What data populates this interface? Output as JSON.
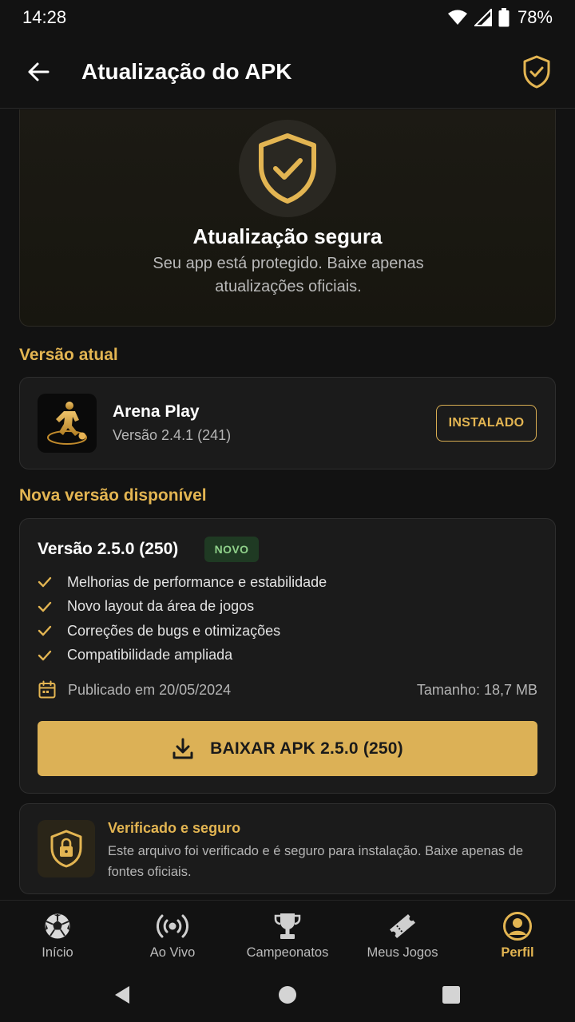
{
  "status_bar": {
    "time": "14:28",
    "battery": "78%"
  },
  "app_bar": {
    "title": "Atualização do APK"
  },
  "hero": {
    "title": "Atualização segura",
    "subtitle": "Seu app está protegido. Baixe apenas atualizações oficiais."
  },
  "current_version": {
    "section_title": "Versão atual",
    "app_name": "Arena Play",
    "version": "Versão 2.4.1 (241)",
    "status_badge": "INSTALADO"
  },
  "new_version": {
    "section_title": "Nova versão disponível",
    "version": "Versão 2.5.0 (250)",
    "badge": "NOVO",
    "features": [
      "Melhorias de performance e estabilidade",
      "Novo layout da área de jogos",
      "Correções de bugs e otimizações",
      "Compatibilidade ampliada"
    ],
    "published": "Publicado em 20/05/2024",
    "size": "Tamanho: 18,7 MB",
    "download_label": "BAIXAR APK 2.5.0 (250)"
  },
  "verification": {
    "title": "Verificado e seguro",
    "text": "Este arquivo foi verificado e é seguro para instalação. Baixe apenas de fontes oficiais."
  },
  "bottom_nav": {
    "items": [
      {
        "label": "Início",
        "icon": "soccer-ball-icon",
        "active": false
      },
      {
        "label": "Ao Vivo",
        "icon": "broadcast-icon",
        "active": false
      },
      {
        "label": "Campeonatos",
        "icon": "trophy-icon",
        "active": false
      },
      {
        "label": "Meus Jogos",
        "icon": "ticket-icon",
        "active": false
      },
      {
        "label": "Perfil",
        "icon": "profile-icon",
        "active": true
      }
    ]
  },
  "colors": {
    "accent": "#e3b552",
    "button": "#dcb156",
    "background": "#121212",
    "card": "#1b1b1b",
    "new_badge_bg": "#1f3a23",
    "new_badge_text": "#8fd08a"
  }
}
